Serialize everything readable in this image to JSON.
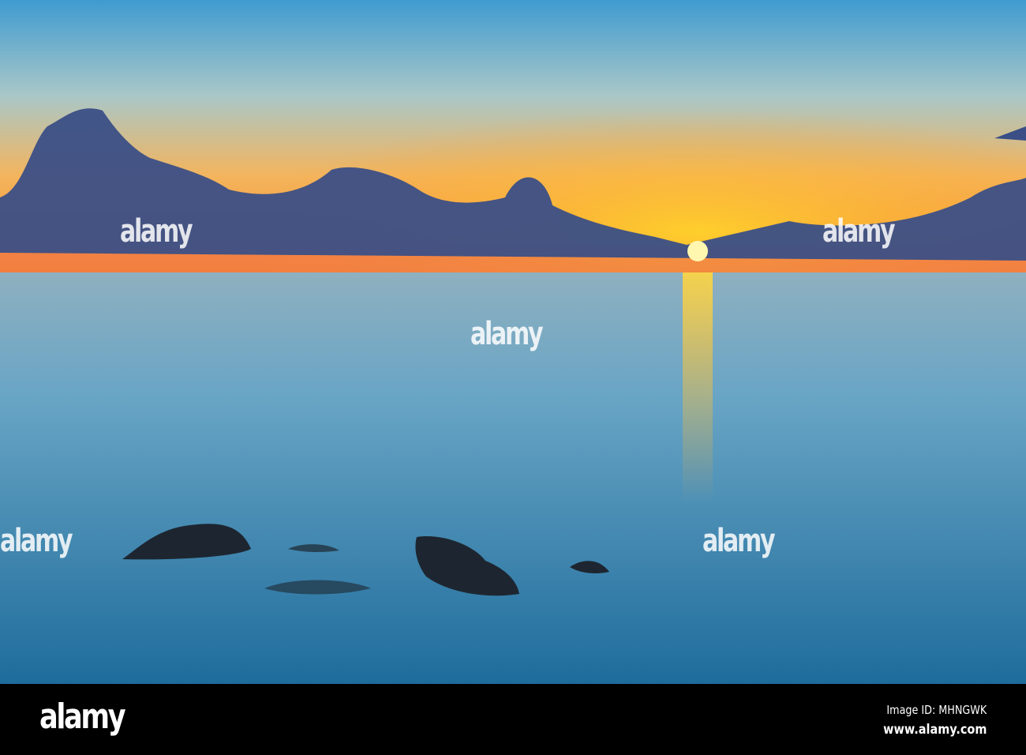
{
  "watermark": {
    "text": "alamy"
  },
  "footer": {
    "logo": "alamy",
    "image_id": "Image ID: MHNGWK",
    "website": "www.alamy.com"
  }
}
